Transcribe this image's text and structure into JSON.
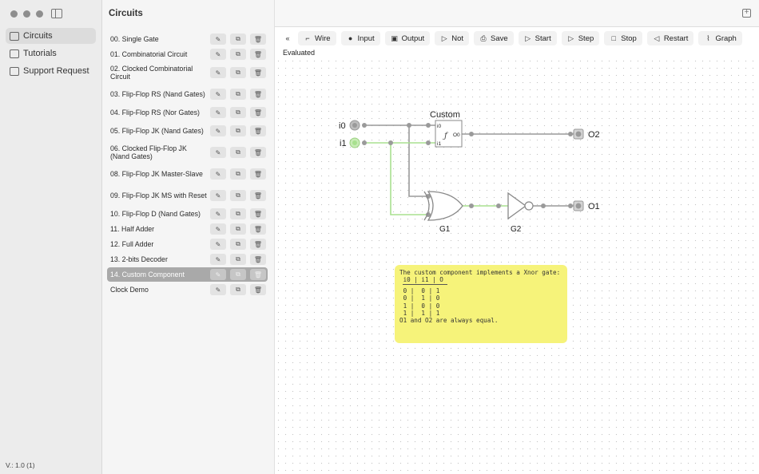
{
  "sidebar": {
    "items": [
      {
        "label": "Circuits",
        "icon": "circuit-icon"
      },
      {
        "label": "Tutorials",
        "icon": "book-icon"
      },
      {
        "label": "Support Request",
        "icon": "envelope-icon"
      }
    ],
    "version": "V.: 1.0 (1)"
  },
  "list": {
    "title": "Circuits",
    "rows": [
      {
        "label": "00. Single Gate"
      },
      {
        "label": "01. Combinatorial Circuit"
      },
      {
        "label": "02. Clocked Combinatorial Circuit"
      },
      {
        "label": "03. Flip-Flop RS (Nand Gates)"
      },
      {
        "label": "04. Flip-Flop RS (Nor Gates)"
      },
      {
        "label": "05. Flip-Flop JK (Nand Gates)"
      },
      {
        "label": "06. Clocked Flip-Flop JK (Nand Gates)"
      },
      {
        "label": "08. Flip-Flop JK Master-Slave"
      },
      {
        "label": "09. Flip-Flop JK MS with Reset"
      },
      {
        "label": "10. Flip-Flop D (Nand Gates)"
      },
      {
        "label": "11. Half Adder"
      },
      {
        "label": "12. Full Adder"
      },
      {
        "label": "13. 2-bits Decoder"
      },
      {
        "label": "14. Custom Component"
      },
      {
        "label": "Clock Demo"
      }
    ],
    "selected_index": 13
  },
  "toolbar": {
    "collapse": "«",
    "wire": "Wire",
    "input": "Input",
    "output": "Output",
    "not": "Not",
    "save": "Save",
    "start": "Start",
    "step": "Step",
    "stop": "Stop",
    "restart": "Restart",
    "graph": "Graph"
  },
  "status": "Evaluated",
  "circuit": {
    "inputs": [
      "i0",
      "i1"
    ],
    "custom_label": "Custom",
    "custom_pins": [
      "i0",
      "i1",
      "O0"
    ],
    "custom_symbol": "ƒ",
    "gates": [
      "G1",
      "G2"
    ],
    "outputs": [
      "O2",
      "O1"
    ]
  },
  "note": {
    "lines": [
      "The custom component implements a Xnor gate:",
      "",
      " i0 | i1 | O",
      " 0 |  0 | 1",
      " 0 |  1 | 0",
      " 1 |  0 | 0",
      " 1 |  1 | 1",
      "",
      "O1 and O2 are always equal."
    ]
  },
  "colors": {
    "active_wire": "#a8e08f",
    "inactive_wire": "#9a9a9a",
    "note_bg": "#f6f37a"
  }
}
